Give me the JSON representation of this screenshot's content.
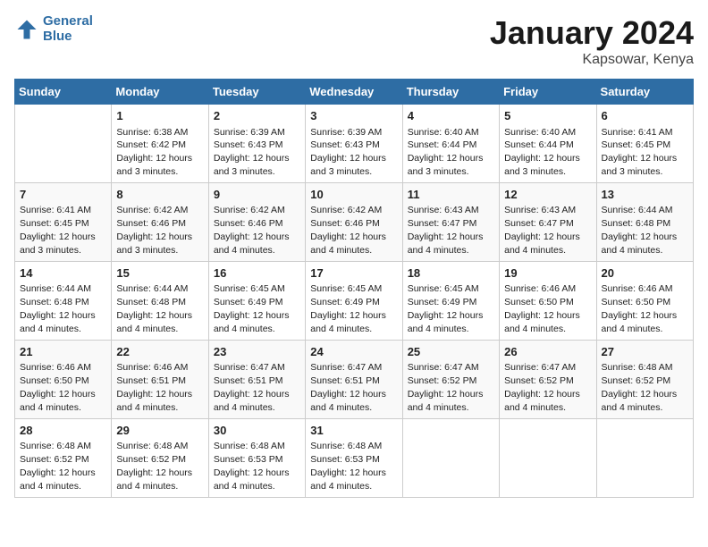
{
  "header": {
    "logo_line1": "General",
    "logo_line2": "Blue",
    "month": "January 2024",
    "location": "Kapsowar, Kenya"
  },
  "weekdays": [
    "Sunday",
    "Monday",
    "Tuesday",
    "Wednesday",
    "Thursday",
    "Friday",
    "Saturday"
  ],
  "weeks": [
    [
      {
        "day": "",
        "sunrise": "",
        "sunset": "",
        "daylight": ""
      },
      {
        "day": "1",
        "sunrise": "Sunrise: 6:38 AM",
        "sunset": "Sunset: 6:42 PM",
        "daylight": "Daylight: 12 hours and 3 minutes."
      },
      {
        "day": "2",
        "sunrise": "Sunrise: 6:39 AM",
        "sunset": "Sunset: 6:43 PM",
        "daylight": "Daylight: 12 hours and 3 minutes."
      },
      {
        "day": "3",
        "sunrise": "Sunrise: 6:39 AM",
        "sunset": "Sunset: 6:43 PM",
        "daylight": "Daylight: 12 hours and 3 minutes."
      },
      {
        "day": "4",
        "sunrise": "Sunrise: 6:40 AM",
        "sunset": "Sunset: 6:44 PM",
        "daylight": "Daylight: 12 hours and 3 minutes."
      },
      {
        "day": "5",
        "sunrise": "Sunrise: 6:40 AM",
        "sunset": "Sunset: 6:44 PM",
        "daylight": "Daylight: 12 hours and 3 minutes."
      },
      {
        "day": "6",
        "sunrise": "Sunrise: 6:41 AM",
        "sunset": "Sunset: 6:45 PM",
        "daylight": "Daylight: 12 hours and 3 minutes."
      }
    ],
    [
      {
        "day": "7",
        "sunrise": "Sunrise: 6:41 AM",
        "sunset": "Sunset: 6:45 PM",
        "daylight": "Daylight: 12 hours and 3 minutes."
      },
      {
        "day": "8",
        "sunrise": "Sunrise: 6:42 AM",
        "sunset": "Sunset: 6:46 PM",
        "daylight": "Daylight: 12 hours and 3 minutes."
      },
      {
        "day": "9",
        "sunrise": "Sunrise: 6:42 AM",
        "sunset": "Sunset: 6:46 PM",
        "daylight": "Daylight: 12 hours and 4 minutes."
      },
      {
        "day": "10",
        "sunrise": "Sunrise: 6:42 AM",
        "sunset": "Sunset: 6:46 PM",
        "daylight": "Daylight: 12 hours and 4 minutes."
      },
      {
        "day": "11",
        "sunrise": "Sunrise: 6:43 AM",
        "sunset": "Sunset: 6:47 PM",
        "daylight": "Daylight: 12 hours and 4 minutes."
      },
      {
        "day": "12",
        "sunrise": "Sunrise: 6:43 AM",
        "sunset": "Sunset: 6:47 PM",
        "daylight": "Daylight: 12 hours and 4 minutes."
      },
      {
        "day": "13",
        "sunrise": "Sunrise: 6:44 AM",
        "sunset": "Sunset: 6:48 PM",
        "daylight": "Daylight: 12 hours and 4 minutes."
      }
    ],
    [
      {
        "day": "14",
        "sunrise": "Sunrise: 6:44 AM",
        "sunset": "Sunset: 6:48 PM",
        "daylight": "Daylight: 12 hours and 4 minutes."
      },
      {
        "day": "15",
        "sunrise": "Sunrise: 6:44 AM",
        "sunset": "Sunset: 6:48 PM",
        "daylight": "Daylight: 12 hours and 4 minutes."
      },
      {
        "day": "16",
        "sunrise": "Sunrise: 6:45 AM",
        "sunset": "Sunset: 6:49 PM",
        "daylight": "Daylight: 12 hours and 4 minutes."
      },
      {
        "day": "17",
        "sunrise": "Sunrise: 6:45 AM",
        "sunset": "Sunset: 6:49 PM",
        "daylight": "Daylight: 12 hours and 4 minutes."
      },
      {
        "day": "18",
        "sunrise": "Sunrise: 6:45 AM",
        "sunset": "Sunset: 6:49 PM",
        "daylight": "Daylight: 12 hours and 4 minutes."
      },
      {
        "day": "19",
        "sunrise": "Sunrise: 6:46 AM",
        "sunset": "Sunset: 6:50 PM",
        "daylight": "Daylight: 12 hours and 4 minutes."
      },
      {
        "day": "20",
        "sunrise": "Sunrise: 6:46 AM",
        "sunset": "Sunset: 6:50 PM",
        "daylight": "Daylight: 12 hours and 4 minutes."
      }
    ],
    [
      {
        "day": "21",
        "sunrise": "Sunrise: 6:46 AM",
        "sunset": "Sunset: 6:50 PM",
        "daylight": "Daylight: 12 hours and 4 minutes."
      },
      {
        "day": "22",
        "sunrise": "Sunrise: 6:46 AM",
        "sunset": "Sunset: 6:51 PM",
        "daylight": "Daylight: 12 hours and 4 minutes."
      },
      {
        "day": "23",
        "sunrise": "Sunrise: 6:47 AM",
        "sunset": "Sunset: 6:51 PM",
        "daylight": "Daylight: 12 hours and 4 minutes."
      },
      {
        "day": "24",
        "sunrise": "Sunrise: 6:47 AM",
        "sunset": "Sunset: 6:51 PM",
        "daylight": "Daylight: 12 hours and 4 minutes."
      },
      {
        "day": "25",
        "sunrise": "Sunrise: 6:47 AM",
        "sunset": "Sunset: 6:52 PM",
        "daylight": "Daylight: 12 hours and 4 minutes."
      },
      {
        "day": "26",
        "sunrise": "Sunrise: 6:47 AM",
        "sunset": "Sunset: 6:52 PM",
        "daylight": "Daylight: 12 hours and 4 minutes."
      },
      {
        "day": "27",
        "sunrise": "Sunrise: 6:48 AM",
        "sunset": "Sunset: 6:52 PM",
        "daylight": "Daylight: 12 hours and 4 minutes."
      }
    ],
    [
      {
        "day": "28",
        "sunrise": "Sunrise: 6:48 AM",
        "sunset": "Sunset: 6:52 PM",
        "daylight": "Daylight: 12 hours and 4 minutes."
      },
      {
        "day": "29",
        "sunrise": "Sunrise: 6:48 AM",
        "sunset": "Sunset: 6:52 PM",
        "daylight": "Daylight: 12 hours and 4 minutes."
      },
      {
        "day": "30",
        "sunrise": "Sunrise: 6:48 AM",
        "sunset": "Sunset: 6:53 PM",
        "daylight": "Daylight: 12 hours and 4 minutes."
      },
      {
        "day": "31",
        "sunrise": "Sunrise: 6:48 AM",
        "sunset": "Sunset: 6:53 PM",
        "daylight": "Daylight: 12 hours and 4 minutes."
      },
      {
        "day": "",
        "sunrise": "",
        "sunset": "",
        "daylight": ""
      },
      {
        "day": "",
        "sunrise": "",
        "sunset": "",
        "daylight": ""
      },
      {
        "day": "",
        "sunrise": "",
        "sunset": "",
        "daylight": ""
      }
    ]
  ]
}
